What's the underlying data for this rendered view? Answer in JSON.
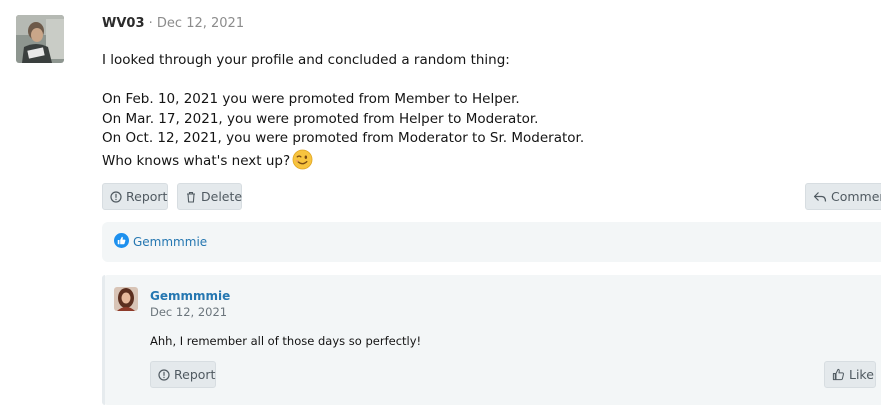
{
  "post": {
    "author": "WV03",
    "separator": "·",
    "date": "Dec 12, 2021",
    "line1": "I looked through your profile and concluded a random thing:",
    "line2": "On Feb. 10, 2021 you were promoted from Member to Helper.",
    "line3": "On Mar. 17, 2021, you were promoted from Helper to Moderator.",
    "line4": "On Oct. 12, 2021, you were promoted from Moderator to Sr. Moderator.",
    "line5": "Who knows what's next up?",
    "emoji": "wink-emoji-icon"
  },
  "actions": {
    "report_label": "Report",
    "delete_label": "Delete",
    "comment_label": "Comment"
  },
  "reactions": {
    "icon": "thumbs-up-icon",
    "users": "Gemmmmie"
  },
  "reply": {
    "author": "Gemmmmie",
    "date": "Dec 12, 2021",
    "text": "Ahh, I remember all of those days so perfectly!",
    "report_label": "Report",
    "like_label": "Like"
  },
  "colors": {
    "link": "#2577b1",
    "button_bg": "#e4e9ec",
    "panel_bg": "#f3f6f7",
    "like_badge": "#1d90ee"
  }
}
